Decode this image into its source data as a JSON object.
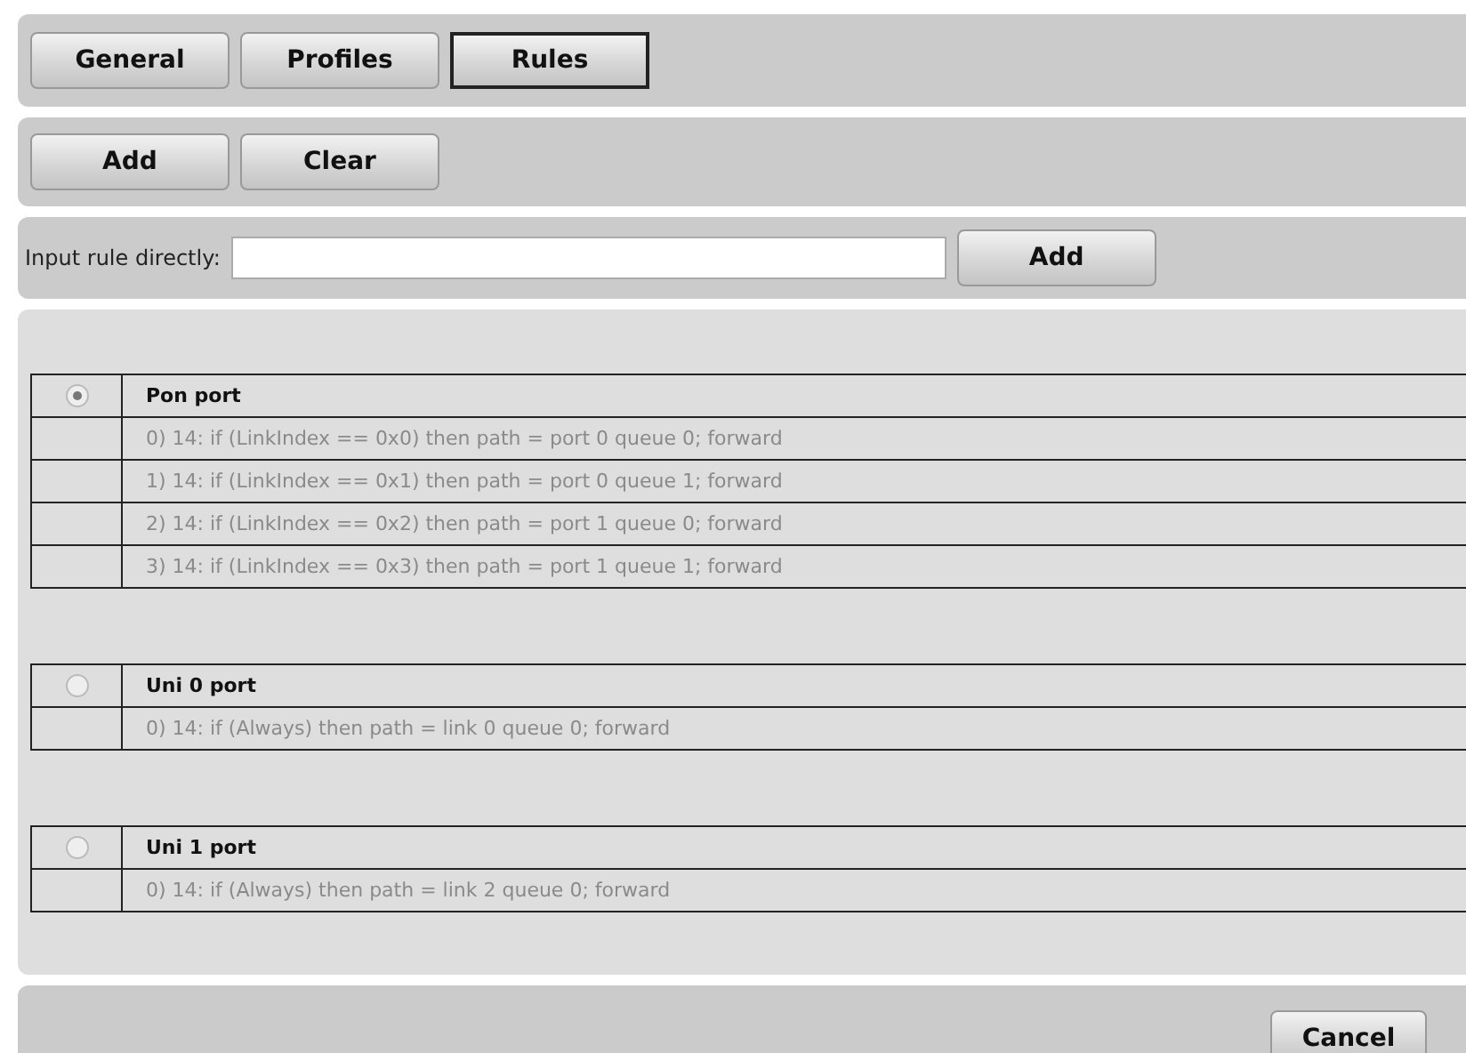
{
  "tabs": [
    {
      "label": "General",
      "selected": false
    },
    {
      "label": "Profiles",
      "selected": false
    },
    {
      "label": "Rules",
      "selected": true
    }
  ],
  "actions": [
    "Add",
    "Clear"
  ],
  "input_rule": {
    "label": "Input rule directly:",
    "button": "Add"
  },
  "ports": [
    {
      "name": "Pon port",
      "selected": true,
      "rules": [
        "0) 14: if (LinkIndex == 0x0) then path = port 0 queue 0; forward",
        "1) 14: if (LinkIndex == 0x1) then path = port 0 queue 1; forward",
        "2) 14: if (LinkIndex == 0x2) then path = port 1 queue 0; forward",
        "3) 14: if (LinkIndex == 0x3) then path = port 1 queue 1; forward"
      ]
    },
    {
      "name": "Uni 0 port",
      "selected": false,
      "rules": [
        "0) 14: if (Always) then path = link 0 queue 0; forward"
      ]
    },
    {
      "name": "Uni 1 port",
      "selected": false,
      "rules": [
        "0) 14: if (Always) then path = link 2 queue 0; forward"
      ]
    }
  ],
  "footer": {
    "button": "Cancel"
  }
}
